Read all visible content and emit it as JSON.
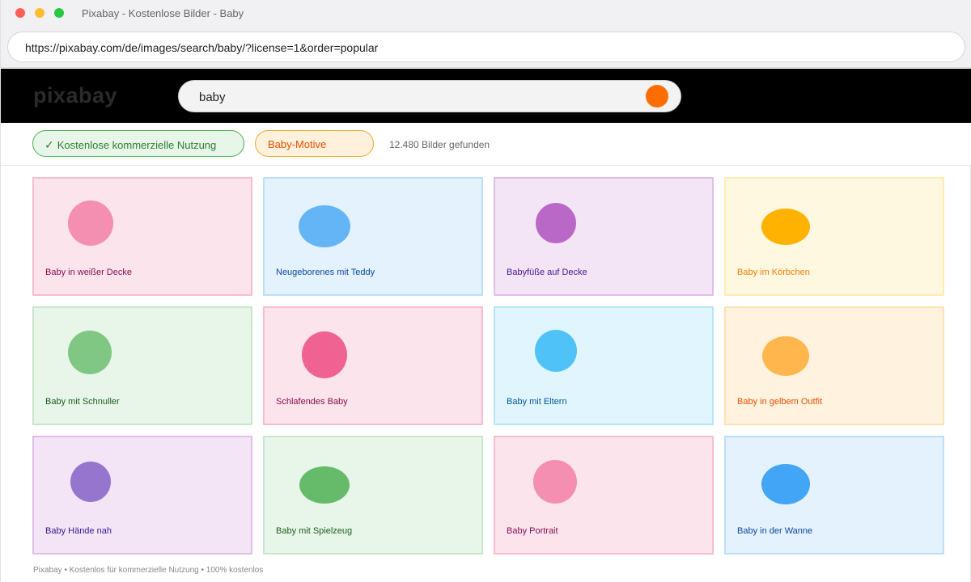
{
  "window": {
    "title": "Pixabay - Kostenlose Bilder - Baby"
  },
  "browser": {
    "url": "https://pixabay.com/de/images/search/baby/?license=1&order=popular"
  },
  "header": {
    "logo": "pixabay",
    "search": {
      "value": "baby",
      "button_color": "#ff6d00"
    }
  },
  "filters": {
    "license": {
      "check": "✓",
      "label": "Kostenlose kommerzielle Nutzung"
    },
    "topic": {
      "label": "Baby-Motive"
    },
    "result_count": "12.480 Bilder gefunden"
  },
  "results": [
    {
      "caption": "Baby in weißer Decke",
      "bg": "#fce4ec",
      "border": "#f8bbd0",
      "blob": "#f48fb1",
      "text": "#880e4f"
    },
    {
      "caption": "Neugeborenes mit Teddy",
      "bg": "#e3f2fd",
      "border": "#bbdefb",
      "blob": "#64b5f6",
      "text": "#0d47a1"
    },
    {
      "caption": "Babyfüße auf Decke",
      "bg": "#f3e5f5",
      "border": "#e1bee7",
      "blob": "#ba68c8",
      "text": "#4a148c"
    },
    {
      "caption": "Baby im Körbchen",
      "bg": "#fff8e1",
      "border": "#ffecb3",
      "blob": "#ffb300",
      "text": "#f57c00"
    },
    {
      "caption": "Baby mit Schnuller",
      "bg": "#e8f5e9",
      "border": "#c8e6c9",
      "blob": "#81c784",
      "text": "#1b5e20"
    },
    {
      "caption": "Schlafendes Baby",
      "bg": "#fce4ec",
      "border": "#f8bbd0",
      "blob": "#f06292",
      "text": "#880e4f"
    },
    {
      "caption": "Baby mit Eltern",
      "bg": "#e1f5fe",
      "border": "#b3e5fc",
      "blob": "#4fc3f7",
      "text": "#01579b"
    },
    {
      "caption": "Baby in gelbem Outfit",
      "bg": "#fff3e0",
      "border": "#ffe0b2",
      "blob": "#ffb74d",
      "text": "#e65100"
    },
    {
      "caption": "Baby Hände nah",
      "bg": "#f3e5f5",
      "border": "#e1bee7",
      "blob": "#9575cd",
      "text": "#311b92"
    },
    {
      "caption": "Baby mit Spielzeug",
      "bg": "#e8f5e9",
      "border": "#c8e6c9",
      "blob": "#66bb6a",
      "text": "#1b5e20"
    },
    {
      "caption": "Baby Portrait",
      "bg": "#fce4ec",
      "border": "#f8bbd0",
      "blob": "#f48fb1",
      "text": "#880e4f"
    },
    {
      "caption": "Baby in der Wanne",
      "bg": "#e3f2fd",
      "border": "#bbdefb",
      "blob": "#42a5f5",
      "text": "#0d47a1"
    }
  ],
  "footer": {
    "text": "Pixabay • Kostenlos für kommerzielle Nutzung • 100% kostenlos"
  }
}
